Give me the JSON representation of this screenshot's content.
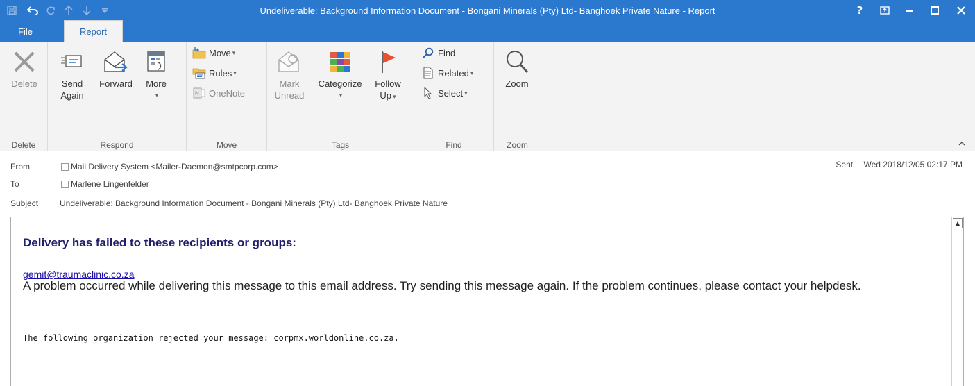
{
  "window": {
    "title": "Undeliverable: Background Information Document - Bongani Minerals (Pty) Ltd- Banghoek Private Nature  - Report",
    "accent": "#2b78cf"
  },
  "quick_access": {
    "save_icon": "save-icon",
    "undo_icon": "undo-icon",
    "redo_icon": "redo-icon",
    "up_icon": "up-arrow-icon",
    "down_icon": "down-arrow-icon",
    "customize_icon": "customize-icon"
  },
  "window_controls": {
    "help": "?",
    "ribbon_options": "⊡",
    "minimize": "–",
    "maximize": "☐",
    "close": "✕"
  },
  "tabs": [
    {
      "label": "File"
    },
    {
      "label": "Report",
      "active": true
    }
  ],
  "ribbon": {
    "groups": {
      "delete": {
        "label": "Delete",
        "delete_button": "Delete"
      },
      "respond": {
        "label": "Respond",
        "send_again_line1": "Send",
        "send_again_line2": "Again",
        "forward": "Forward",
        "more": "More",
        "more_caret": "▾"
      },
      "move": {
        "label": "Move",
        "move": "Move",
        "rules": "Rules",
        "onenote": "OneNote",
        "caret": "▾"
      },
      "tags": {
        "label": "Tags",
        "mark_line1": "Mark",
        "mark_line2": "Unread",
        "categorize": "Categorize",
        "follow_line1": "Follow",
        "follow_line2": "Up",
        "caret": "▾"
      },
      "find": {
        "label": "Find",
        "find": "Find",
        "related": "Related",
        "select": "Select",
        "caret": "▾"
      },
      "zoom": {
        "label": "Zoom",
        "zoom": "Zoom"
      }
    },
    "collapse_glyph": "^"
  },
  "message": {
    "from_label": "From",
    "from_value": "Mail Delivery System <Mailer-Daemon@smtpcorp.com>",
    "to_label": "To",
    "to_value": "Marlene Lingenfelder",
    "subject_label": "Subject",
    "subject_value": "Undeliverable: Background Information Document - Bongani Minerals (Pty) Ltd- Banghoek Private Nature",
    "sent_label": "Sent",
    "sent_value": "Wed 2018/12/05 02:17 PM"
  },
  "body": {
    "headline": "Delivery has failed to these recipients or groups:",
    "recipient": "gemit@traumaclinic.co.za",
    "problem": "A problem occurred while delivering this message to this email address. Try sending this message again. If the problem continues, please contact your helpdesk.",
    "org_message": "The following organization rejected your message: corpmx.worldonline.co.za.",
    "scroll_up": "▲"
  }
}
